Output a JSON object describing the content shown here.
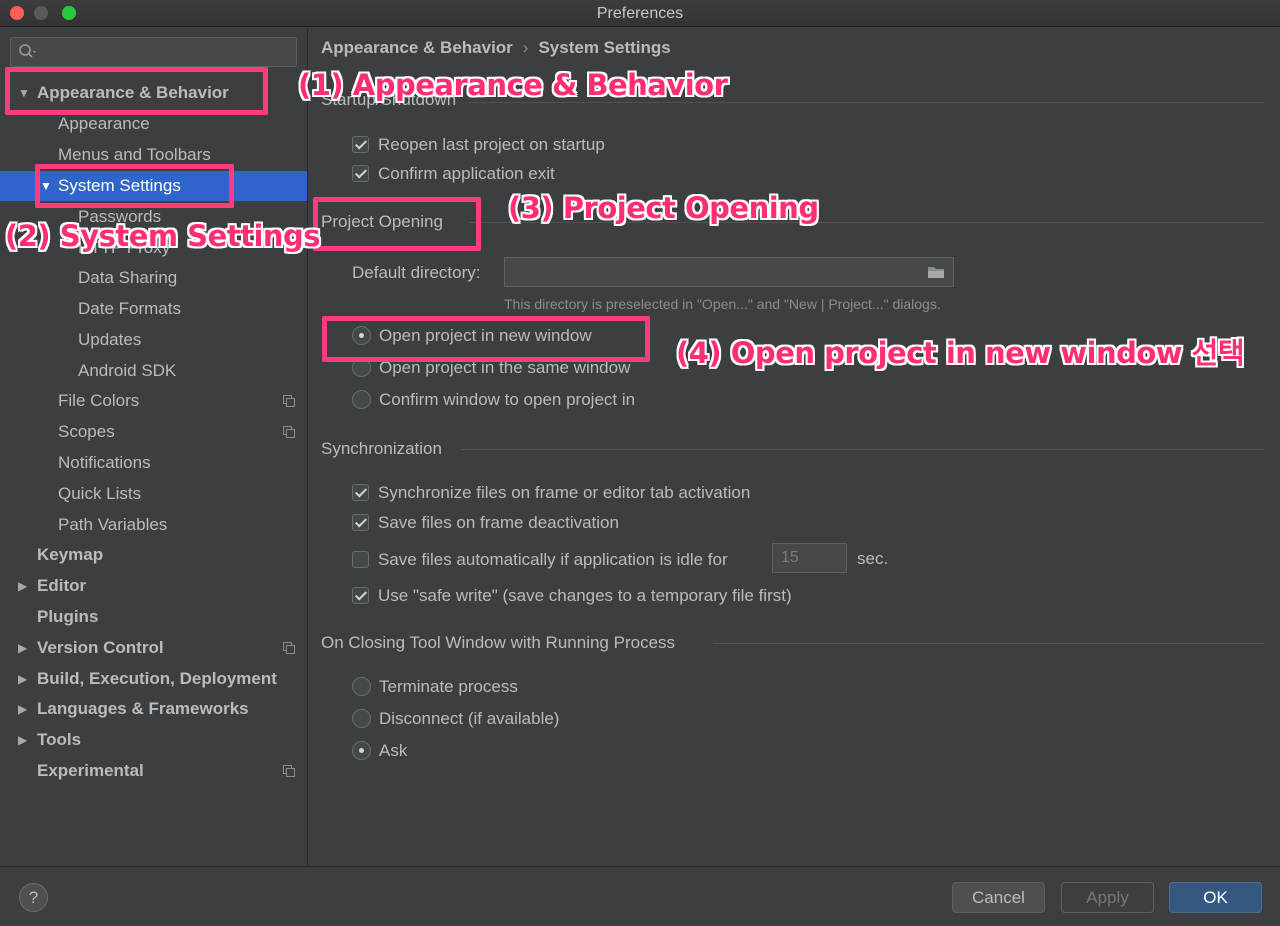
{
  "window": {
    "title": "Preferences"
  },
  "search": {
    "placeholder": ""
  },
  "sidebar": {
    "items": [
      {
        "label": "Appearance & Behavior"
      },
      {
        "label": "Appearance"
      },
      {
        "label": "Menus and Toolbars"
      },
      {
        "label": "System Settings"
      },
      {
        "label": "Passwords"
      },
      {
        "label": "HTTP Proxy"
      },
      {
        "label": "Data Sharing"
      },
      {
        "label": "Date Formats"
      },
      {
        "label": "Updates"
      },
      {
        "label": "Android SDK"
      },
      {
        "label": "File Colors"
      },
      {
        "label": "Scopes"
      },
      {
        "label": "Notifications"
      },
      {
        "label": "Quick Lists"
      },
      {
        "label": "Path Variables"
      },
      {
        "label": "Keymap"
      },
      {
        "label": "Editor"
      },
      {
        "label": "Plugins"
      },
      {
        "label": "Version Control"
      },
      {
        "label": "Build, Execution, Deployment"
      },
      {
        "label": "Languages & Frameworks"
      },
      {
        "label": "Tools"
      },
      {
        "label": "Experimental"
      }
    ]
  },
  "breadcrumb": {
    "parent": "Appearance & Behavior",
    "separator": "›",
    "current": "System Settings"
  },
  "startup": {
    "title": "Startup/Shutdown",
    "reopen_label": "Reopen last project on startup",
    "confirm_exit_label": "Confirm application exit"
  },
  "project_opening": {
    "title": "Project Opening",
    "default_dir_label": "Default directory:",
    "default_dir_value": "",
    "hint": "This directory is preselected in \"Open...\" and \"New | Project...\" dialogs.",
    "options": [
      {
        "label": "Open project in new window",
        "selected": true
      },
      {
        "label": "Open project in the same window",
        "selected": false
      },
      {
        "label": "Confirm window to open project in",
        "selected": false
      }
    ]
  },
  "synchronization": {
    "title": "Synchronization",
    "sync_files_label": "Synchronize files on frame or editor tab activation",
    "save_deactivation_label": "Save files on frame deactivation",
    "save_idle_label": "Save files automatically if application is idle for",
    "idle_seconds": "15",
    "idle_unit": "sec.",
    "safe_write_label": "Use \"safe write\" (save changes to a temporary file first)"
  },
  "closing": {
    "title": "On Closing Tool Window with Running Process",
    "options": [
      {
        "label": "Terminate process",
        "selected": false
      },
      {
        "label": "Disconnect (if available)",
        "selected": false
      },
      {
        "label": "Ask",
        "selected": true
      }
    ]
  },
  "annotations": {
    "a1": "(1) Appearance & Behavior",
    "a2": "(2) System Settings",
    "a3": "(3) Project Opening",
    "a4": "(4) Open project in new window 선택",
    "color": "#ff2e73"
  },
  "footer": {
    "help": "?",
    "cancel": "Cancel",
    "apply": "Apply",
    "ok": "OK"
  },
  "colors": {
    "background": "#3c3f41",
    "selection": "#2f65ca",
    "primary_button": "#365880"
  }
}
